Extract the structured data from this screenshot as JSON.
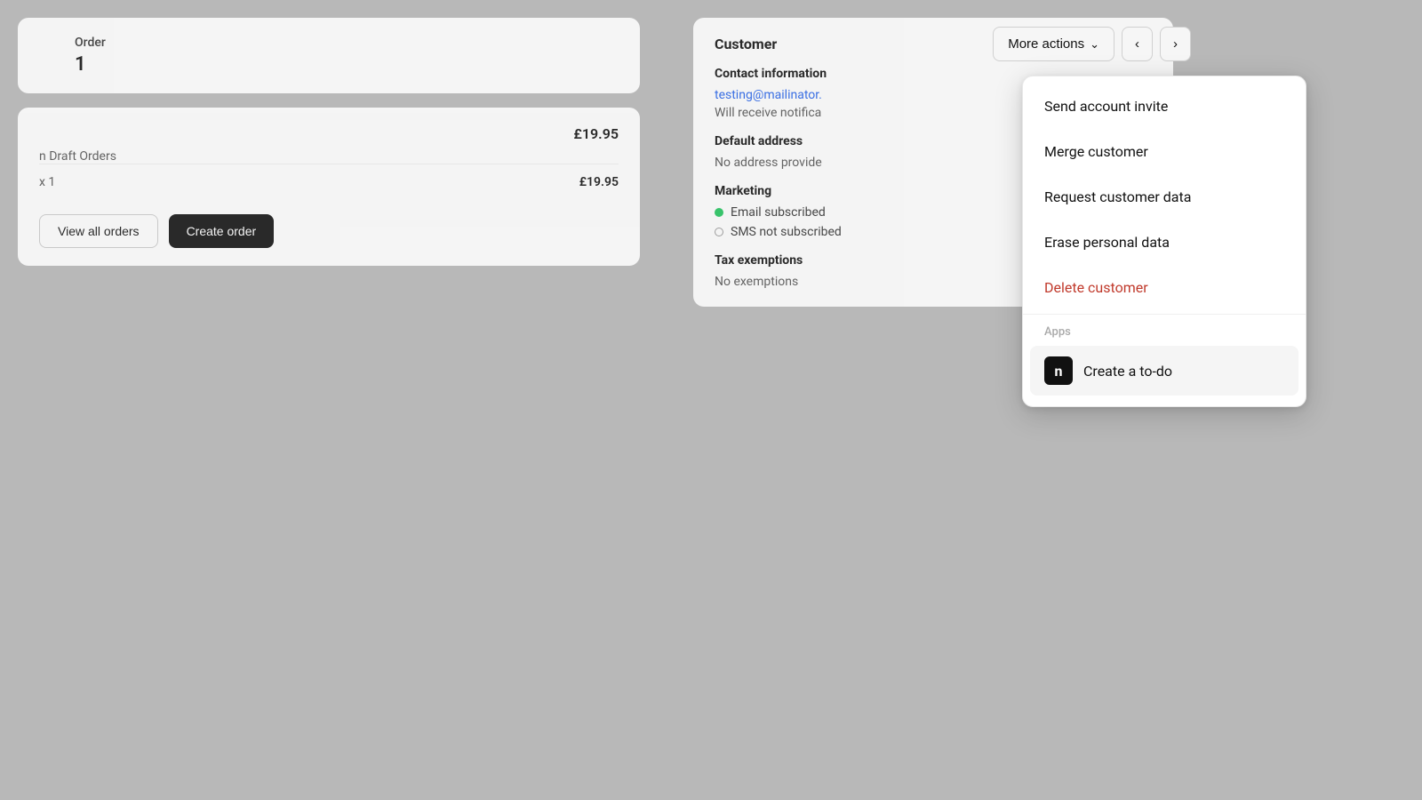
{
  "toolbar": {
    "more_actions_label": "More actions",
    "chevron": "⌄",
    "nav_prev": "‹",
    "nav_next": "›"
  },
  "dropdown": {
    "items": [
      {
        "id": "send-account-invite",
        "label": "Send account invite",
        "type": "normal"
      },
      {
        "id": "merge-customer",
        "label": "Merge customer",
        "type": "normal"
      },
      {
        "id": "request-customer-data",
        "label": "Request customer data",
        "type": "normal"
      },
      {
        "id": "erase-personal-data",
        "label": "Erase personal data",
        "type": "normal"
      },
      {
        "id": "delete-customer",
        "label": "Delete customer",
        "type": "danger"
      }
    ],
    "section_label": "Apps",
    "app_item": {
      "icon": "n",
      "label": "Create a to-do"
    }
  },
  "left_panel": {
    "col1_label": "",
    "col2_label": "Order",
    "col2_value": "1",
    "order_amount": "£19.95",
    "draft_label": "n Draft Orders",
    "line_qty": "x 1",
    "line_price": "£19.95",
    "btn_view_orders": "View all orders",
    "btn_create_order": "Create order"
  },
  "right_panel": {
    "customer_title": "Customer",
    "contact_title": "Contact information",
    "email": "testing@mailinator.",
    "email_note": "Will receive notifica",
    "address_title": "Default address",
    "address_value": "No address provide",
    "marketing_title": "Marketing",
    "email_subscribed": "Email subscribed",
    "sms_not_subscribed": "SMS not subscribed",
    "tax_title": "Tax exemptions",
    "tax_value": "No exemptions"
  }
}
